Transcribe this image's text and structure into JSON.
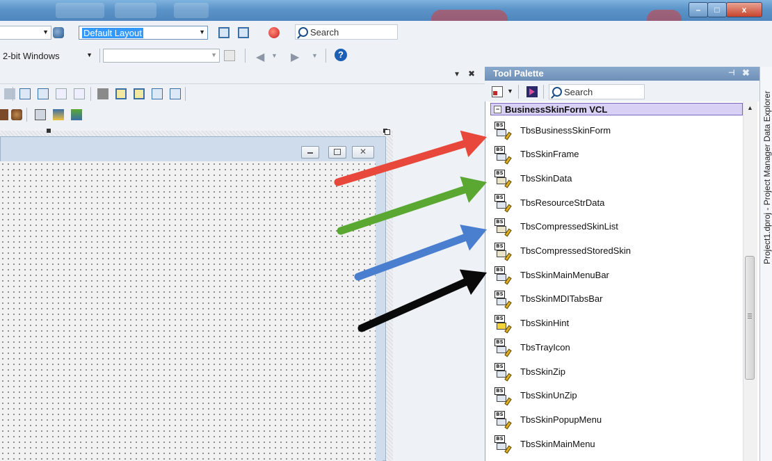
{
  "toolbar": {
    "layout_combo": "Default Layout",
    "search_placeholder": "Search",
    "platform_combo": "2-bit Windows",
    "config_combo": ""
  },
  "window": {
    "minimize": "–",
    "maximize": "□",
    "close": "x"
  },
  "designer": {
    "dock_pin": "▾",
    "dock_close": "✖"
  },
  "palette": {
    "title": "Tool Palette",
    "search_placeholder": "Search",
    "category": "BusinessSkinForm VCL",
    "items": [
      {
        "label": "TbsBusinessSkinForm",
        "icon": "bs-form-icon"
      },
      {
        "label": "TbsSkinFrame",
        "icon": "bs-frame-icon"
      },
      {
        "label": "TbsSkinData",
        "icon": "bs-data-icon"
      },
      {
        "label": "TbsResourceStrData",
        "icon": "bs-resource-str-icon"
      },
      {
        "label": "TbsCompressedSkinList",
        "icon": "bs-compressed-list-icon"
      },
      {
        "label": "TbsCompressedStoredSkin",
        "icon": "bs-compressed-stored-icon"
      },
      {
        "label": "TbsSkinMainMenuBar",
        "icon": "bs-menubar-icon"
      },
      {
        "label": "TbsSkinMDITabsBar",
        "icon": "bs-mditabs-icon"
      },
      {
        "label": "TbsSkinHint",
        "icon": "bs-hint-icon"
      },
      {
        "label": "TbsTrayIcon",
        "icon": "bs-tray-icon"
      },
      {
        "label": "TbsSkinZip",
        "icon": "bs-zip-icon"
      },
      {
        "label": "TbsSkinUnZip",
        "icon": "bs-unzip-icon"
      },
      {
        "label": "TbsSkinPopupMenu",
        "icon": "bs-popup-menu-icon"
      },
      {
        "label": "TbsSkinMainMenu",
        "icon": "bs-main-menu-icon"
      }
    ]
  },
  "side_tabs": {
    "text": "Project1.dproj - Project Manager  Data Explorer"
  },
  "annotations": {
    "arrow_colors": [
      "#e8473b",
      "#5aa832",
      "#4a7fd0",
      "#0a0a0a"
    ]
  }
}
